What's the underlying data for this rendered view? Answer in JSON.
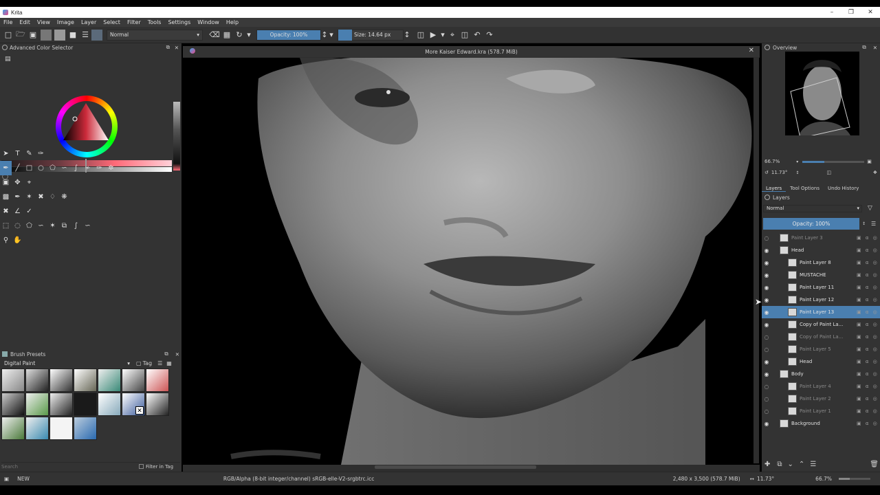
{
  "app": {
    "title": "Krita",
    "document_title": "More Kaiser Edward.kra (578.7 MiB)"
  },
  "menu": [
    "File",
    "Edit",
    "View",
    "Image",
    "Layer",
    "Select",
    "Filter",
    "Tools",
    "Settings",
    "Window",
    "Help"
  ],
  "toolbar": {
    "blend_mode": "Normal",
    "opacity": "Opacity: 100%",
    "size": "Size: 14.64 px"
  },
  "color_selector": {
    "title": "Advanced Color Selector"
  },
  "brush_presets": {
    "title": "Brush Presets",
    "tag": "Digital Paint",
    "tag_label": "Tag",
    "search_placeholder": "Search",
    "filter_in_tag": "Filter in Tag"
  },
  "overview": {
    "title": "Overview",
    "zoom": "66.7%",
    "rotation": "11.73°"
  },
  "dock_tabs": [
    "Layers",
    "Tool Options",
    "Undo History"
  ],
  "layers": {
    "title": "Layers",
    "blend_mode": "Normal",
    "opacity": "Opacity:  100%",
    "items": [
      {
        "name": "Paint Layer 3",
        "dim": true,
        "indent": 1
      },
      {
        "name": "Head",
        "dim": false,
        "indent": 1
      },
      {
        "name": "Paint Layer 8",
        "dim": false,
        "indent": 2
      },
      {
        "name": "MUSTACHE",
        "dim": false,
        "indent": 2
      },
      {
        "name": "Paint Layer 11",
        "dim": false,
        "indent": 2
      },
      {
        "name": "Paint Layer 12",
        "dim": false,
        "indent": 2
      },
      {
        "name": "Paint Layer 13",
        "dim": false,
        "indent": 2,
        "selected": true
      },
      {
        "name": "Copy of Paint La...",
        "dim": false,
        "indent": 2
      },
      {
        "name": "Copy of Paint La...",
        "dim": true,
        "indent": 2
      },
      {
        "name": "Paint Layer 5",
        "dim": true,
        "indent": 2
      },
      {
        "name": "Head",
        "dim": false,
        "indent": 2
      },
      {
        "name": "Body",
        "dim": false,
        "indent": 1
      },
      {
        "name": "Paint Layer 4",
        "dim": true,
        "indent": 2
      },
      {
        "name": "Paint Layer 2",
        "dim": true,
        "indent": 2
      },
      {
        "name": "Paint Layer 1",
        "dim": true,
        "indent": 2
      },
      {
        "name": "Background",
        "dim": false,
        "indent": 1
      }
    ]
  },
  "status": {
    "mode": "NEW",
    "color_info": "RGB/Alpha (8-bit integer/channel)  sRGB-elle-V2-srgbtrc.icc",
    "image_size": "2,480 x 3,500 (578.7 MiB)",
    "rotation": "11.73°",
    "zoom": "66.7%"
  },
  "colors": {
    "accent": "#4a7fb0",
    "panel": "#333333",
    "titlebar": "#ffffff"
  }
}
